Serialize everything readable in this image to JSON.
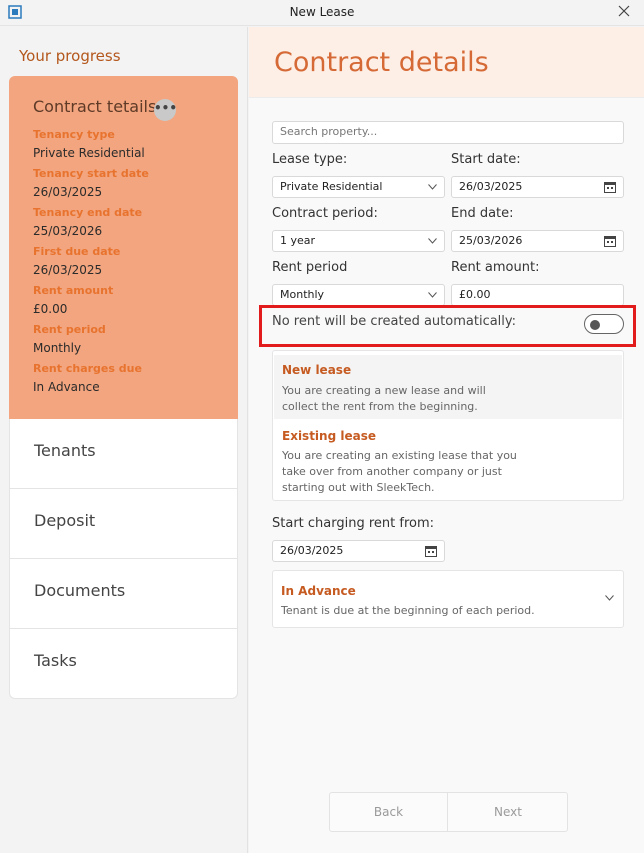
{
  "window": {
    "title": "New Lease"
  },
  "sidebar": {
    "progress_title": "Your progress",
    "contract": {
      "heading": "Contract tetails",
      "more_label": "•••",
      "fields": [
        {
          "label": "Tenancy type",
          "value": "Private Residential"
        },
        {
          "label": "Tenancy start date",
          "value": "26/03/2025"
        },
        {
          "label": "Tenancy end date",
          "value": "25/03/2026"
        },
        {
          "label": "First due date",
          "value": "26/03/2025"
        },
        {
          "label": "Rent amount",
          "value": "£0.00"
        },
        {
          "label": "Rent period",
          "value": "Monthly"
        },
        {
          "label": "Rent charges due",
          "value": "In Advance"
        }
      ]
    },
    "steps": [
      "Tenants",
      "Deposit",
      "Documents",
      "Tasks"
    ]
  },
  "main": {
    "title": "Contract details",
    "search_placeholder": "Search property...",
    "lease_type": {
      "label": "Lease type:",
      "value": "Private Residential"
    },
    "start_date": {
      "label": "Start date:",
      "value": "26/03/2025"
    },
    "contract_period": {
      "label": "Contract period:",
      "value": "1 year"
    },
    "end_date": {
      "label": "End date:",
      "value": "25/03/2026"
    },
    "rent_period": {
      "label": "Rent period",
      "value": "Monthly"
    },
    "rent_amount": {
      "label": "Rent amount:",
      "value": "£0.00"
    },
    "auto_rent": {
      "label": "No rent will be created automatically:",
      "enabled": false
    },
    "lease_options": [
      {
        "title": "New lease",
        "description": "You are creating a new lease and will collect the rent from the beginning.",
        "selected": true
      },
      {
        "title": "Existing lease",
        "description": "You are creating an existing lease that you take over from another company or just starting out with SleekTech.",
        "selected": false
      }
    ],
    "start_charging": {
      "label": "Start charging rent from:",
      "value": "26/03/2025"
    },
    "charge_timing": {
      "title": "In Advance",
      "description": "Tenant is due at the beginning of each period."
    },
    "buttons": {
      "back": "Back",
      "next": "Next"
    }
  },
  "colors": {
    "accent": "#f2a57e",
    "accent_text": "#c65b22",
    "highlight": "#e21c1c"
  }
}
